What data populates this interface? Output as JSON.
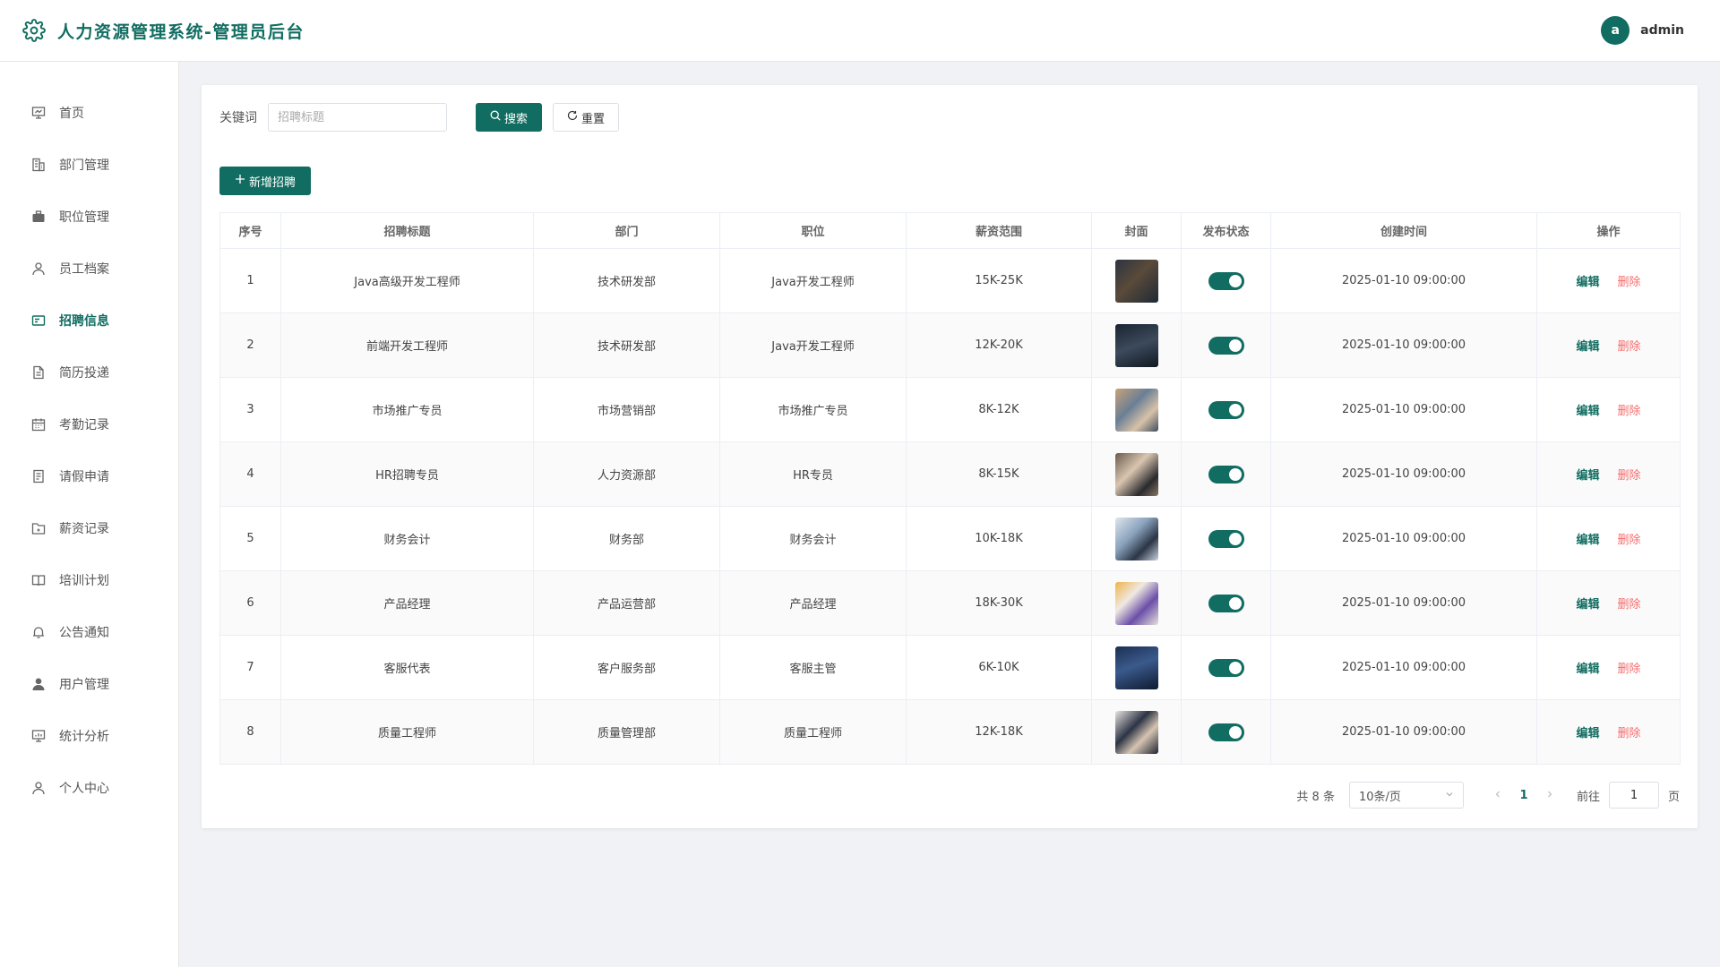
{
  "header": {
    "title": "人力资源管理系统-管理员后台",
    "avatar_letter": "a",
    "username": "admin"
  },
  "sidebar": {
    "items": [
      {
        "label": "首页",
        "icon": "monitor-icon"
      },
      {
        "label": "部门管理",
        "icon": "building-icon"
      },
      {
        "label": "职位管理",
        "icon": "briefcase-icon"
      },
      {
        "label": "员工档案",
        "icon": "user-icon"
      },
      {
        "label": "招聘信息",
        "icon": "id-card-icon",
        "active": true
      },
      {
        "label": "简历投递",
        "icon": "document-icon"
      },
      {
        "label": "考勤记录",
        "icon": "calendar-icon"
      },
      {
        "label": "请假申请",
        "icon": "tickets-icon"
      },
      {
        "label": "薪资记录",
        "icon": "folder-icon"
      },
      {
        "label": "培训计划",
        "icon": "book-icon"
      },
      {
        "label": "公告通知",
        "icon": "bell-icon"
      },
      {
        "label": "用户管理",
        "icon": "user-filled-icon"
      },
      {
        "label": "统计分析",
        "icon": "chart-board-icon"
      },
      {
        "label": "个人中心",
        "icon": "user-icon"
      }
    ]
  },
  "search": {
    "label": "关键词",
    "placeholder": "招聘标题",
    "search_button": "搜索",
    "reset_button": "重置"
  },
  "actions": {
    "add_button": "新增招聘"
  },
  "table": {
    "columns": [
      "序号",
      "招聘标题",
      "部门",
      "职位",
      "薪资范围",
      "封面",
      "发布状态",
      "创建时间",
      "操作"
    ],
    "edit_label": "编辑",
    "delete_label": "删除",
    "rows": [
      {
        "index": "1",
        "title": "Java高级开发工程师",
        "dept": "技术研发部",
        "position": "Java开发工程师",
        "salary": "15K-25K",
        "created": "2025-01-10 09:00:00",
        "published": true
      },
      {
        "index": "2",
        "title": "前端开发工程师",
        "dept": "技术研发部",
        "position": "Java开发工程师",
        "salary": "12K-20K",
        "created": "2025-01-10 09:00:00",
        "published": true
      },
      {
        "index": "3",
        "title": "市场推广专员",
        "dept": "市场营销部",
        "position": "市场推广专员",
        "salary": "8K-12K",
        "created": "2025-01-10 09:00:00",
        "published": true
      },
      {
        "index": "4",
        "title": "HR招聘专员",
        "dept": "人力资源部",
        "position": "HR专员",
        "salary": "8K-15K",
        "created": "2025-01-10 09:00:00",
        "published": true
      },
      {
        "index": "5",
        "title": "财务会计",
        "dept": "财务部",
        "position": "财务会计",
        "salary": "10K-18K",
        "created": "2025-01-10 09:00:00",
        "published": true
      },
      {
        "index": "6",
        "title": "产品经理",
        "dept": "产品运营部",
        "position": "产品经理",
        "salary": "18K-30K",
        "created": "2025-01-10 09:00:00",
        "published": true
      },
      {
        "index": "7",
        "title": "客服代表",
        "dept": "客户服务部",
        "position": "客服主管",
        "salary": "6K-10K",
        "created": "2025-01-10 09:00:00",
        "published": true
      },
      {
        "index": "8",
        "title": "质量工程师",
        "dept": "质量管理部",
        "position": "质量工程师",
        "salary": "12K-18K",
        "created": "2025-01-10 09:00:00",
        "published": true
      }
    ]
  },
  "pagination": {
    "total": "共 8 条",
    "page_size": "10条/页",
    "current_page": "1",
    "goto_label": "前往",
    "goto_value": "1",
    "page_unit": "页"
  },
  "colors": {
    "primary": "#116d61",
    "danger": "#f56c6c"
  }
}
